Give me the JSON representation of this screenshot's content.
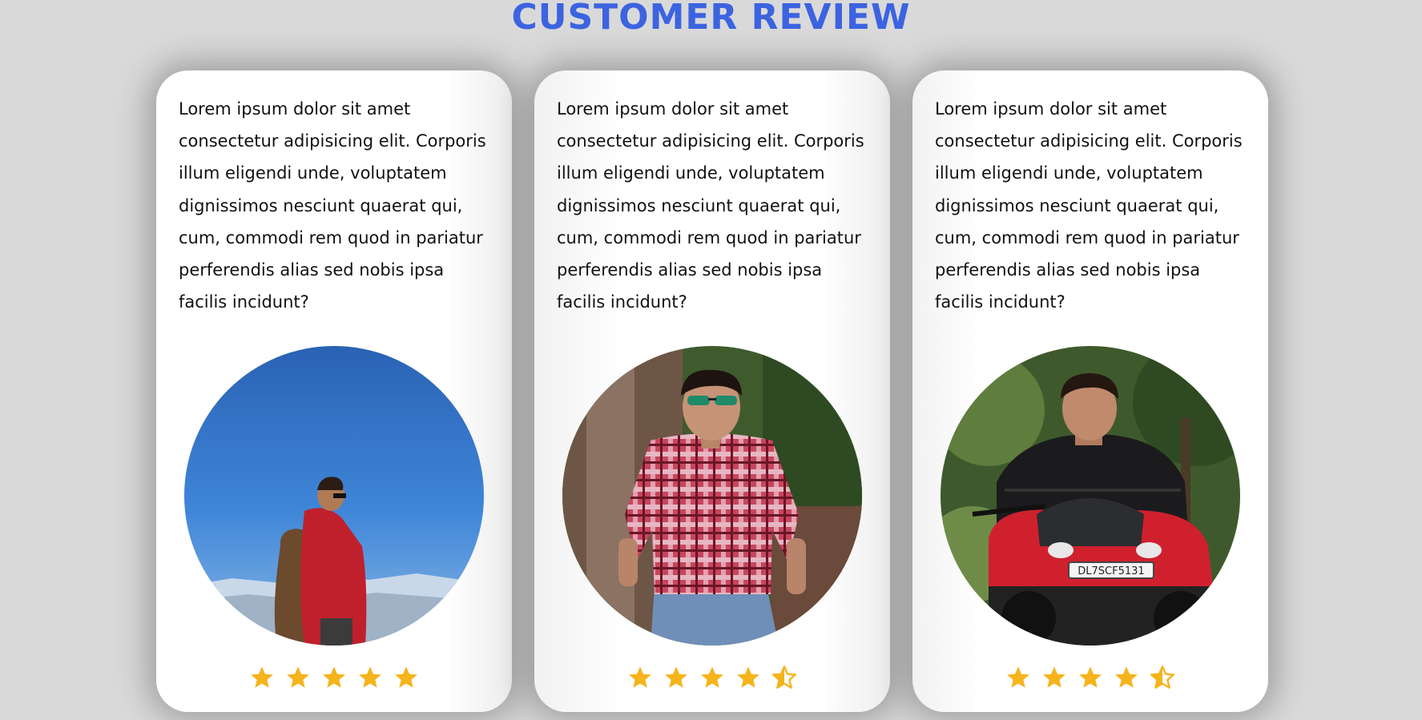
{
  "page": {
    "title": "CUSTOMER REVIEW"
  },
  "reviews": [
    {
      "text": "Lorem ipsum dolor sit amet consectetur adipisicing elit. Corporis illum eligendi unde, voluptatem dignissimos nesciunt quaerat qui, cum, commodi rem quod in pariatur perferendis alias sed nobis ipsa facilis incidunt?",
      "photo": "person-red-jacket-sky-photo",
      "rating": 5
    },
    {
      "text": "Lorem ipsum dolor sit amet consectetur adipisicing elit. Corporis illum eligendi unde, voluptatem dignissimos nesciunt quaerat qui, cum, commodi rem quod in pariatur perferendis alias sed nobis ipsa facilis incidunt?",
      "photo": "person-plaid-shirt-tree-photo",
      "rating": 4.5
    },
    {
      "text": "Lorem ipsum dolor sit amet consectetur adipisicing elit. Corporis illum eligendi unde, voluptatem dignissimos nesciunt quaerat qui, cum, commodi rem quod in pariatur perferendis alias sed nobis ipsa facilis incidunt?",
      "photo": "person-motorcycle-forest-photo",
      "rating": 4.5,
      "plate": "DL7SCF5131"
    }
  ],
  "colors": {
    "title": "#3c63e0",
    "star": "#f5b41c",
    "background": "#d9d9d9"
  }
}
